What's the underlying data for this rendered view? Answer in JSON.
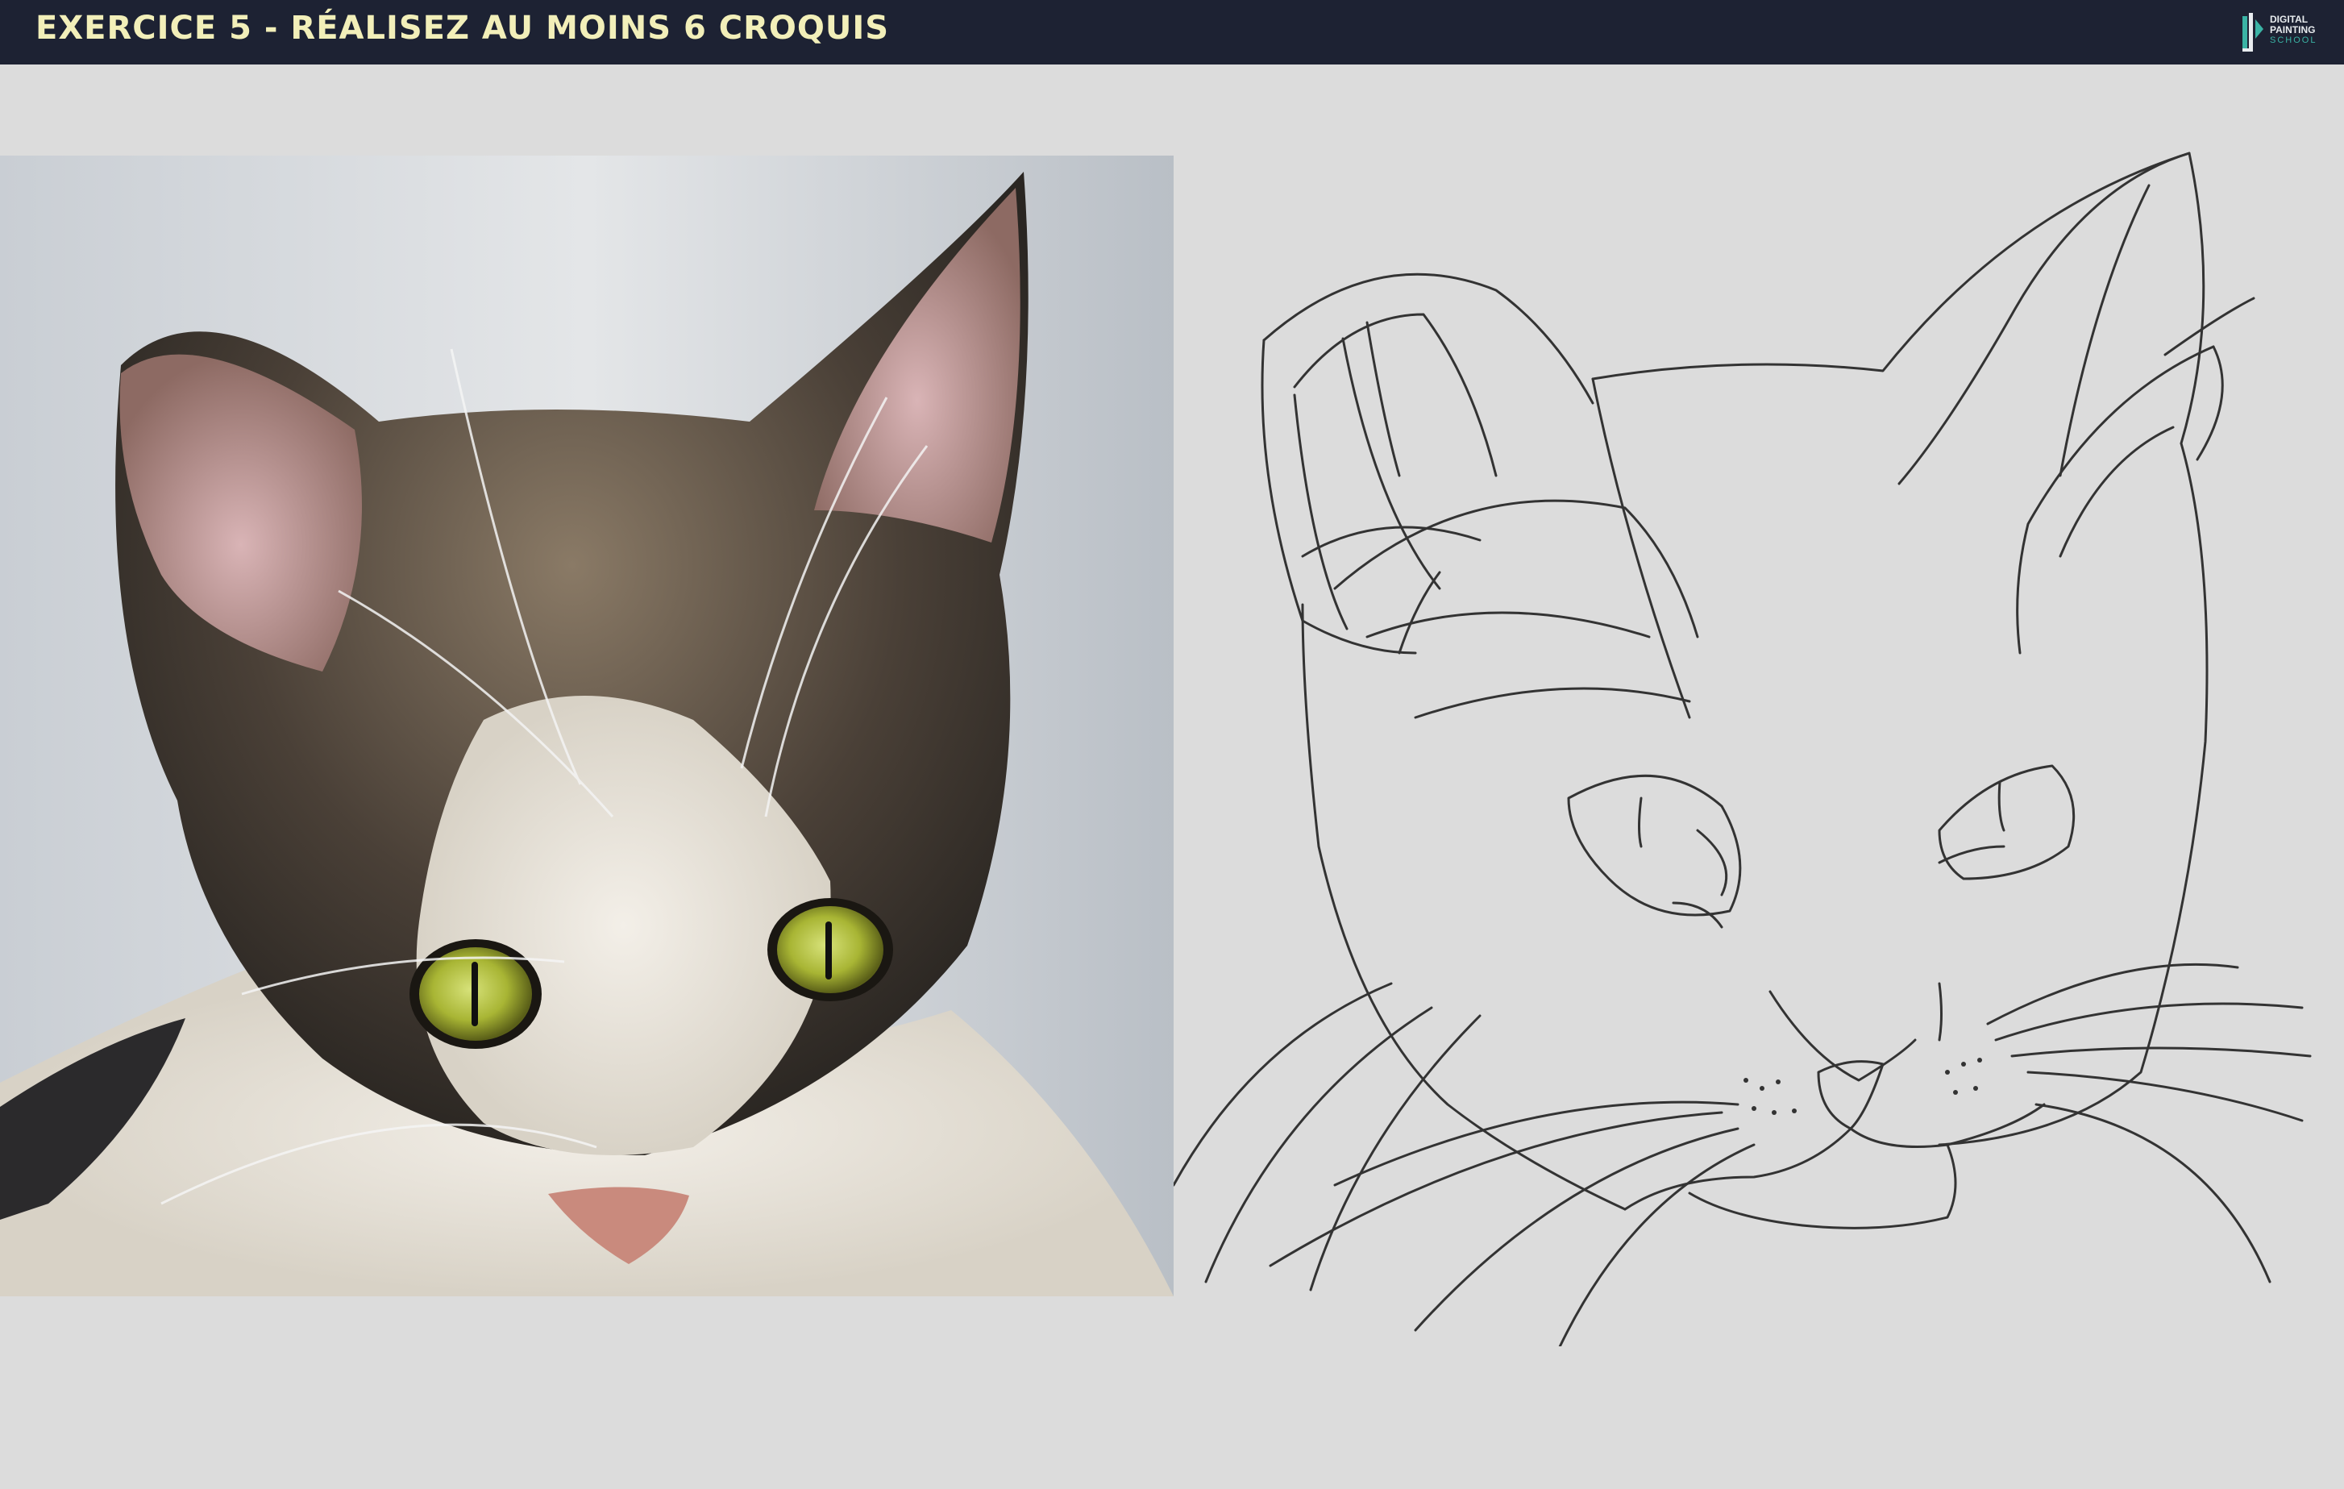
{
  "header": {
    "title": "EXERCICE 5 - RÉALISEZ AU MOINS 6 CROQUIS",
    "logo": {
      "icon": "digital-painting-school-logo-icon",
      "line1": "DIGITAL",
      "line2": "PAINTING",
      "line3": "SCHOOL"
    }
  },
  "colors": {
    "header_bg": "#1d2233",
    "title": "#f2efb9",
    "page_bg": "#dcdcdc",
    "sketch_line": "#333333",
    "logo_accent": "#3ab3a5"
  },
  "content": {
    "reference_photo": "cat-face-reference-photo",
    "sketch": "cat-face-line-sketch"
  }
}
